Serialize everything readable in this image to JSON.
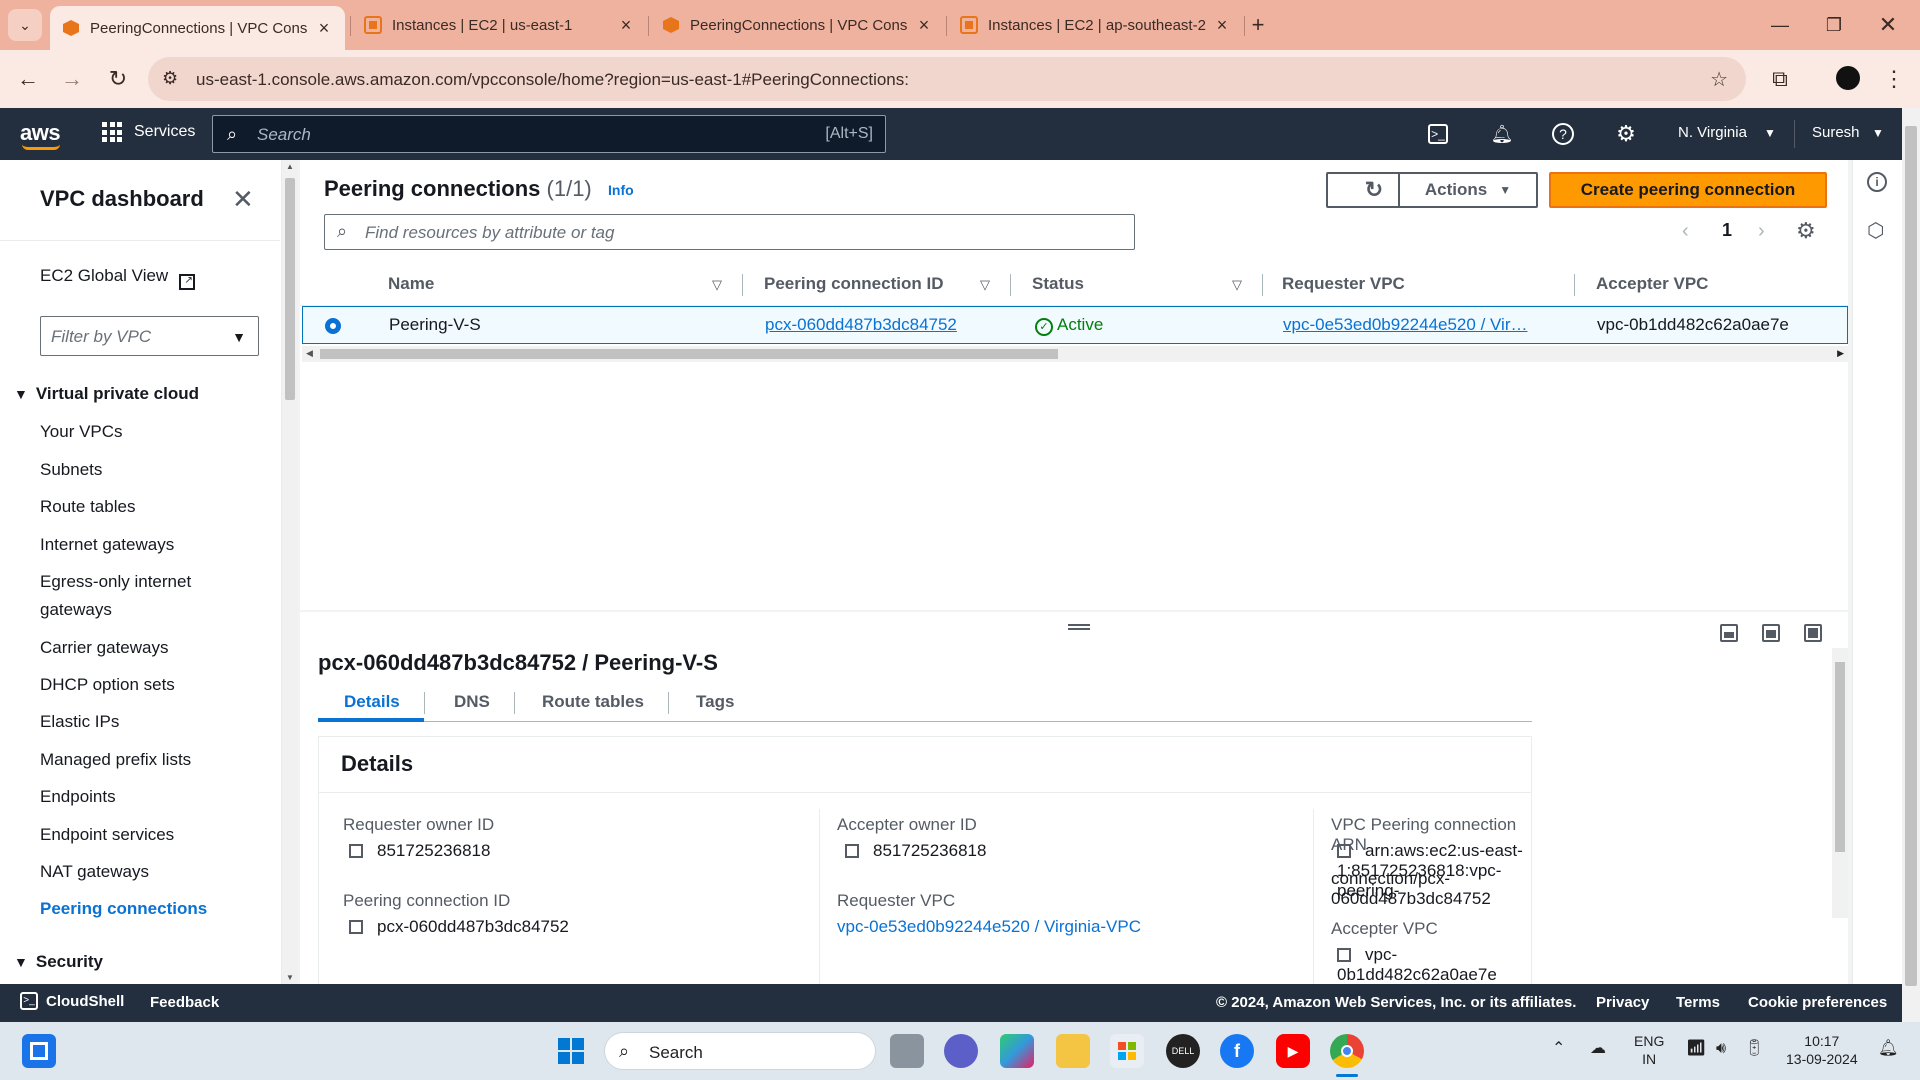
{
  "browser": {
    "tabs": [
      {
        "title": "PeeringConnections | VPC Cons",
        "active": true
      },
      {
        "title": "Instances | EC2 | us-east-1",
        "active": false
      },
      {
        "title": "PeeringConnections | VPC Cons",
        "active": false
      },
      {
        "title": "Instances | EC2 | ap-southeast-2",
        "active": false
      }
    ],
    "url": "us-east-1.console.aws.amazon.com/vpcconsole/home?region=us-east-1#PeeringConnections:"
  },
  "aws_nav": {
    "logo": "aws",
    "services": "Services",
    "search_placeholder": "Search",
    "search_shortcut": "[Alt+S]",
    "region": "N. Virginia",
    "user": "Suresh"
  },
  "sidebar": {
    "title": "VPC dashboard",
    "global_view": "EC2 Global View",
    "filter_placeholder": "Filter by VPC",
    "section_vpc": "Virtual private cloud",
    "items": [
      "Your VPCs",
      "Subnets",
      "Route tables",
      "Internet gateways",
      "Egress-only internet gateways",
      "Carrier gateways",
      "DHCP option sets",
      "Elastic IPs",
      "Managed prefix lists",
      "Endpoints",
      "Endpoint services",
      "NAT gateways",
      "Peering connections"
    ],
    "active_item": "Peering connections",
    "section_security": "Security"
  },
  "table": {
    "title": "Peering connections",
    "count": "(1/1)",
    "info": "Info",
    "actions": "Actions",
    "create": "Create peering connection",
    "search_placeholder": "Find resources by attribute or tag",
    "page": "1",
    "columns": [
      "Name",
      "Peering connection ID",
      "Status",
      "Requester VPC",
      "Accepter VPC"
    ],
    "row": {
      "name": "Peering-V-S",
      "id": "pcx-060dd487b3dc84752",
      "status": "Active",
      "requester_vpc": "vpc-0e53ed0b92244e520 / Vir…",
      "accepter_vpc": "vpc-0b1dd482c62a0ae7e"
    }
  },
  "details": {
    "title": "pcx-060dd487b3dc84752 / Peering-V-S",
    "tabs": [
      "Details",
      "DNS",
      "Route tables",
      "Tags"
    ],
    "box_title": "Details",
    "requester_owner_label": "Requester owner ID",
    "requester_owner": "851725236818",
    "peering_id_label": "Peering connection ID",
    "peering_id": "pcx-060dd487b3dc84752",
    "accepter_owner_label": "Accepter owner ID",
    "accepter_owner": "851725236818",
    "requester_vpc_label": "Requester VPC",
    "requester_vpc": "vpc-0e53ed0b92244e520 / Virginia-VPC",
    "arn_label": "VPC Peering connection ARN",
    "arn_line1": "arn:aws:ec2:us-east-1:851725236818:vpc-peering-",
    "arn_line2": "connection/pcx-060dd487b3dc84752",
    "accepter_vpc_label": "Accepter VPC",
    "accepter_vpc": "vpc-0b1dd482c62a0ae7e"
  },
  "footer": {
    "cloudshell": "CloudShell",
    "feedback": "Feedback",
    "copyright": "© 2024, Amazon Web Services, Inc. or its affiliates.",
    "privacy": "Privacy",
    "terms": "Terms",
    "cookies": "Cookie preferences"
  },
  "taskbar": {
    "search": "Search",
    "lang1": "ENG",
    "lang2": "IN",
    "time": "10:17",
    "date": "13-09-2024"
  },
  "colors": {
    "aws_nav": "#232f3e",
    "aws_orange": "#ff9900",
    "link_blue": "#0972d3",
    "active_green": "#037f0c",
    "browser_tab": "#efb29f"
  }
}
